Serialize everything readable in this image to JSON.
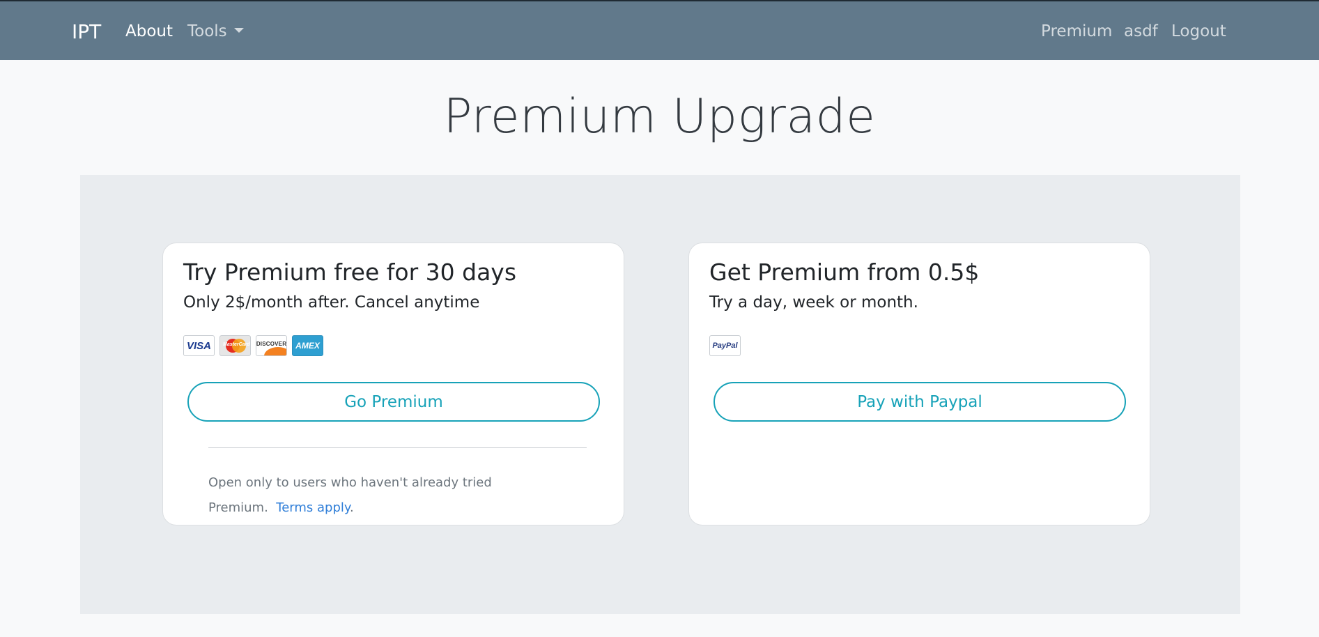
{
  "navbar": {
    "brand": "IPT",
    "links": [
      {
        "label": "About"
      },
      {
        "label": "Tools"
      }
    ],
    "right_links": [
      {
        "label": "Premium"
      },
      {
        "label": "asdf"
      },
      {
        "label": "Logout"
      }
    ]
  },
  "page": {
    "title": "Premium Upgrade"
  },
  "cards": [
    {
      "title": "Try Premium free for 30 days",
      "subtitle": "Only 2$/month after. Cancel anytime",
      "payment_icons": [
        "visa-icon",
        "mastercard-icon",
        "discover-icon",
        "amex-icon"
      ],
      "logo_text": {
        "visa": "VISA",
        "mastercard": "MasterCard",
        "discover": "DISCOVER",
        "amex": "AMEX"
      },
      "button_label": "Go Premium",
      "fine_print": "Open only to users who haven't already tried Premium.",
      "terms_link": "Terms apply",
      "terms_end": "."
    },
    {
      "title": "Get Premium from 0.5$",
      "subtitle": "Try a day, week or month.",
      "payment_icons": [
        "paypal-icon"
      ],
      "logo_text": {
        "paypal": "PayPal"
      },
      "button_label": "Pay with Paypal"
    }
  ],
  "colors": {
    "navbar": "#61798b",
    "accent": "#17a2b8",
    "link": "#2f7ed8",
    "panel": "#e9ecef"
  }
}
